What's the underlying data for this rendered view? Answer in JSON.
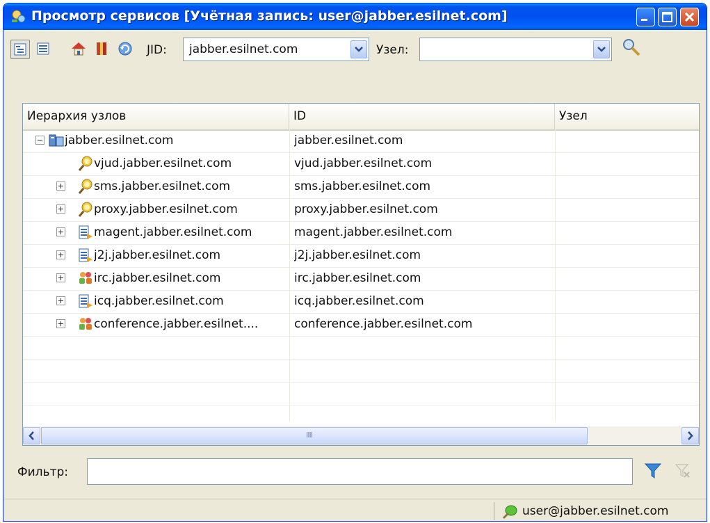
{
  "window": {
    "title": "Просмотр сервисов [Учётная запись: user@jabber.esilnet.com]"
  },
  "toolbar": {
    "jid_label": "JID:",
    "jid_value": "jabber.esilnet.com",
    "node_label": "Узел:",
    "node_value": ""
  },
  "grid": {
    "columns": [
      "Иерархия узлов",
      "ID",
      "Узел"
    ],
    "rows": [
      {
        "name": "jabber.esilnet.com",
        "id": "jabber.esilnet.com",
        "node": "",
        "icon": "server-icon",
        "expander": "minus",
        "level": 0
      },
      {
        "name": "vjud.jabber.esilnet.com",
        "id": "vjud.jabber.esilnet.com",
        "node": "",
        "icon": "search-service-icon",
        "expander": "none",
        "level": 1
      },
      {
        "name": "sms.jabber.esilnet.com",
        "id": "sms.jabber.esilnet.com",
        "node": "",
        "icon": "search-service-icon",
        "expander": "plus",
        "level": 1
      },
      {
        "name": "proxy.jabber.esilnet.com",
        "id": "proxy.jabber.esilnet.com",
        "node": "",
        "icon": "search-service-icon",
        "expander": "plus",
        "level": 1
      },
      {
        "name": "magent.jabber.esilnet.com",
        "id": "magent.jabber.esilnet.com",
        "node": "",
        "icon": "gateway-icon",
        "expander": "plus",
        "level": 1
      },
      {
        "name": "j2j.jabber.esilnet.com",
        "id": "j2j.jabber.esilnet.com",
        "node": "",
        "icon": "gateway-icon",
        "expander": "plus",
        "level": 1
      },
      {
        "name": "irc.jabber.esilnet.com",
        "id": "irc.jabber.esilnet.com",
        "node": "",
        "icon": "conference-icon",
        "expander": "plus",
        "level": 1
      },
      {
        "name": "icq.jabber.esilnet.com",
        "id": "icq.jabber.esilnet.com",
        "node": "",
        "icon": "gateway-icon",
        "expander": "plus",
        "level": 1
      },
      {
        "name": "conference.jabber.esilnet....",
        "id": "conference.jabber.esilnet.com",
        "node": "",
        "icon": "conference-icon",
        "expander": "plus",
        "level": 1
      }
    ],
    "scroll_grip": "IIII"
  },
  "filter": {
    "label": "Фильтр:",
    "value": ""
  },
  "status": {
    "account": "user@jabber.esilnet.com"
  },
  "colors": {
    "titlebar": "#0055ea",
    "window_bg": "#ece9d8",
    "border": "#7f9db9"
  }
}
